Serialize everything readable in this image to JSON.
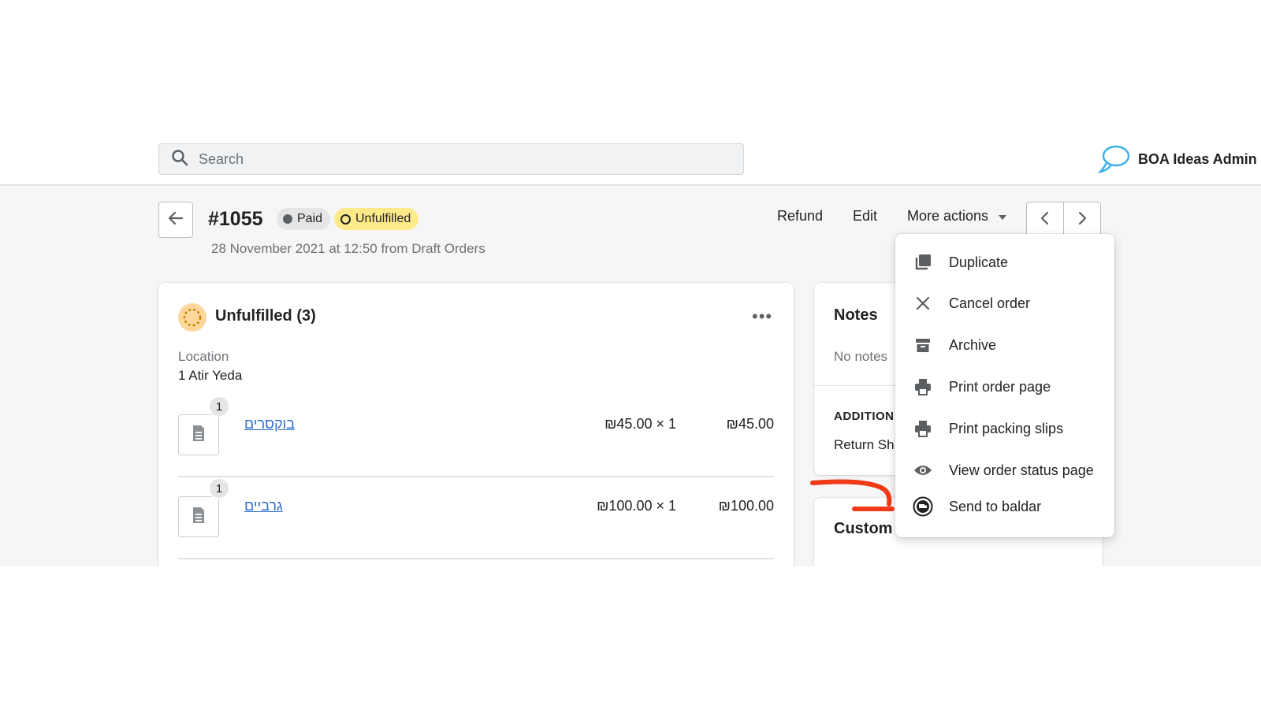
{
  "search": {
    "placeholder": "Search"
  },
  "store": {
    "name": "BOA Ideas Admin"
  },
  "order": {
    "number": "#1055",
    "payment_status": "Paid",
    "fulfillment_status": "Unfulfilled",
    "subtitle": "28 November 2021 at 12:50 from Draft Orders"
  },
  "header_actions": {
    "refund": "Refund",
    "edit": "Edit",
    "more_actions": "More actions"
  },
  "fulfillment_card": {
    "title": "Unfulfilled (3)",
    "location_label": "Location",
    "location_value": "1 Atir Yeda",
    "items": [
      {
        "qty": "1",
        "name": "בוקסרים",
        "unit_price": "₪45.00 × 1",
        "total": "₪45.00"
      },
      {
        "qty": "1",
        "name": "גרביים",
        "unit_price": "₪100.00 × 1",
        "total": "₪100.00"
      }
    ]
  },
  "notes_card": {
    "title": "Notes",
    "empty_text": "No notes",
    "additional_title": "ADDITION",
    "additional_value": "Return Sh"
  },
  "customer_card": {
    "title": "Custom"
  },
  "menu": {
    "items": [
      {
        "label": "Duplicate",
        "icon": "duplicate-icon"
      },
      {
        "label": "Cancel order",
        "icon": "close-icon"
      },
      {
        "label": "Archive",
        "icon": "archive-icon"
      },
      {
        "label": "Print order page",
        "icon": "printer-icon"
      },
      {
        "label": "Print packing slips",
        "icon": "printer-icon"
      },
      {
        "label": "View order status page",
        "icon": "eye-icon"
      },
      {
        "label": "Send to baldar",
        "icon": "baldar-truck-icon"
      }
    ]
  },
  "colors": {
    "accent_link": "#2c6ecb",
    "unfulfilled_badge": "#ffea8a",
    "annotation_arrow": "#f03a17"
  }
}
